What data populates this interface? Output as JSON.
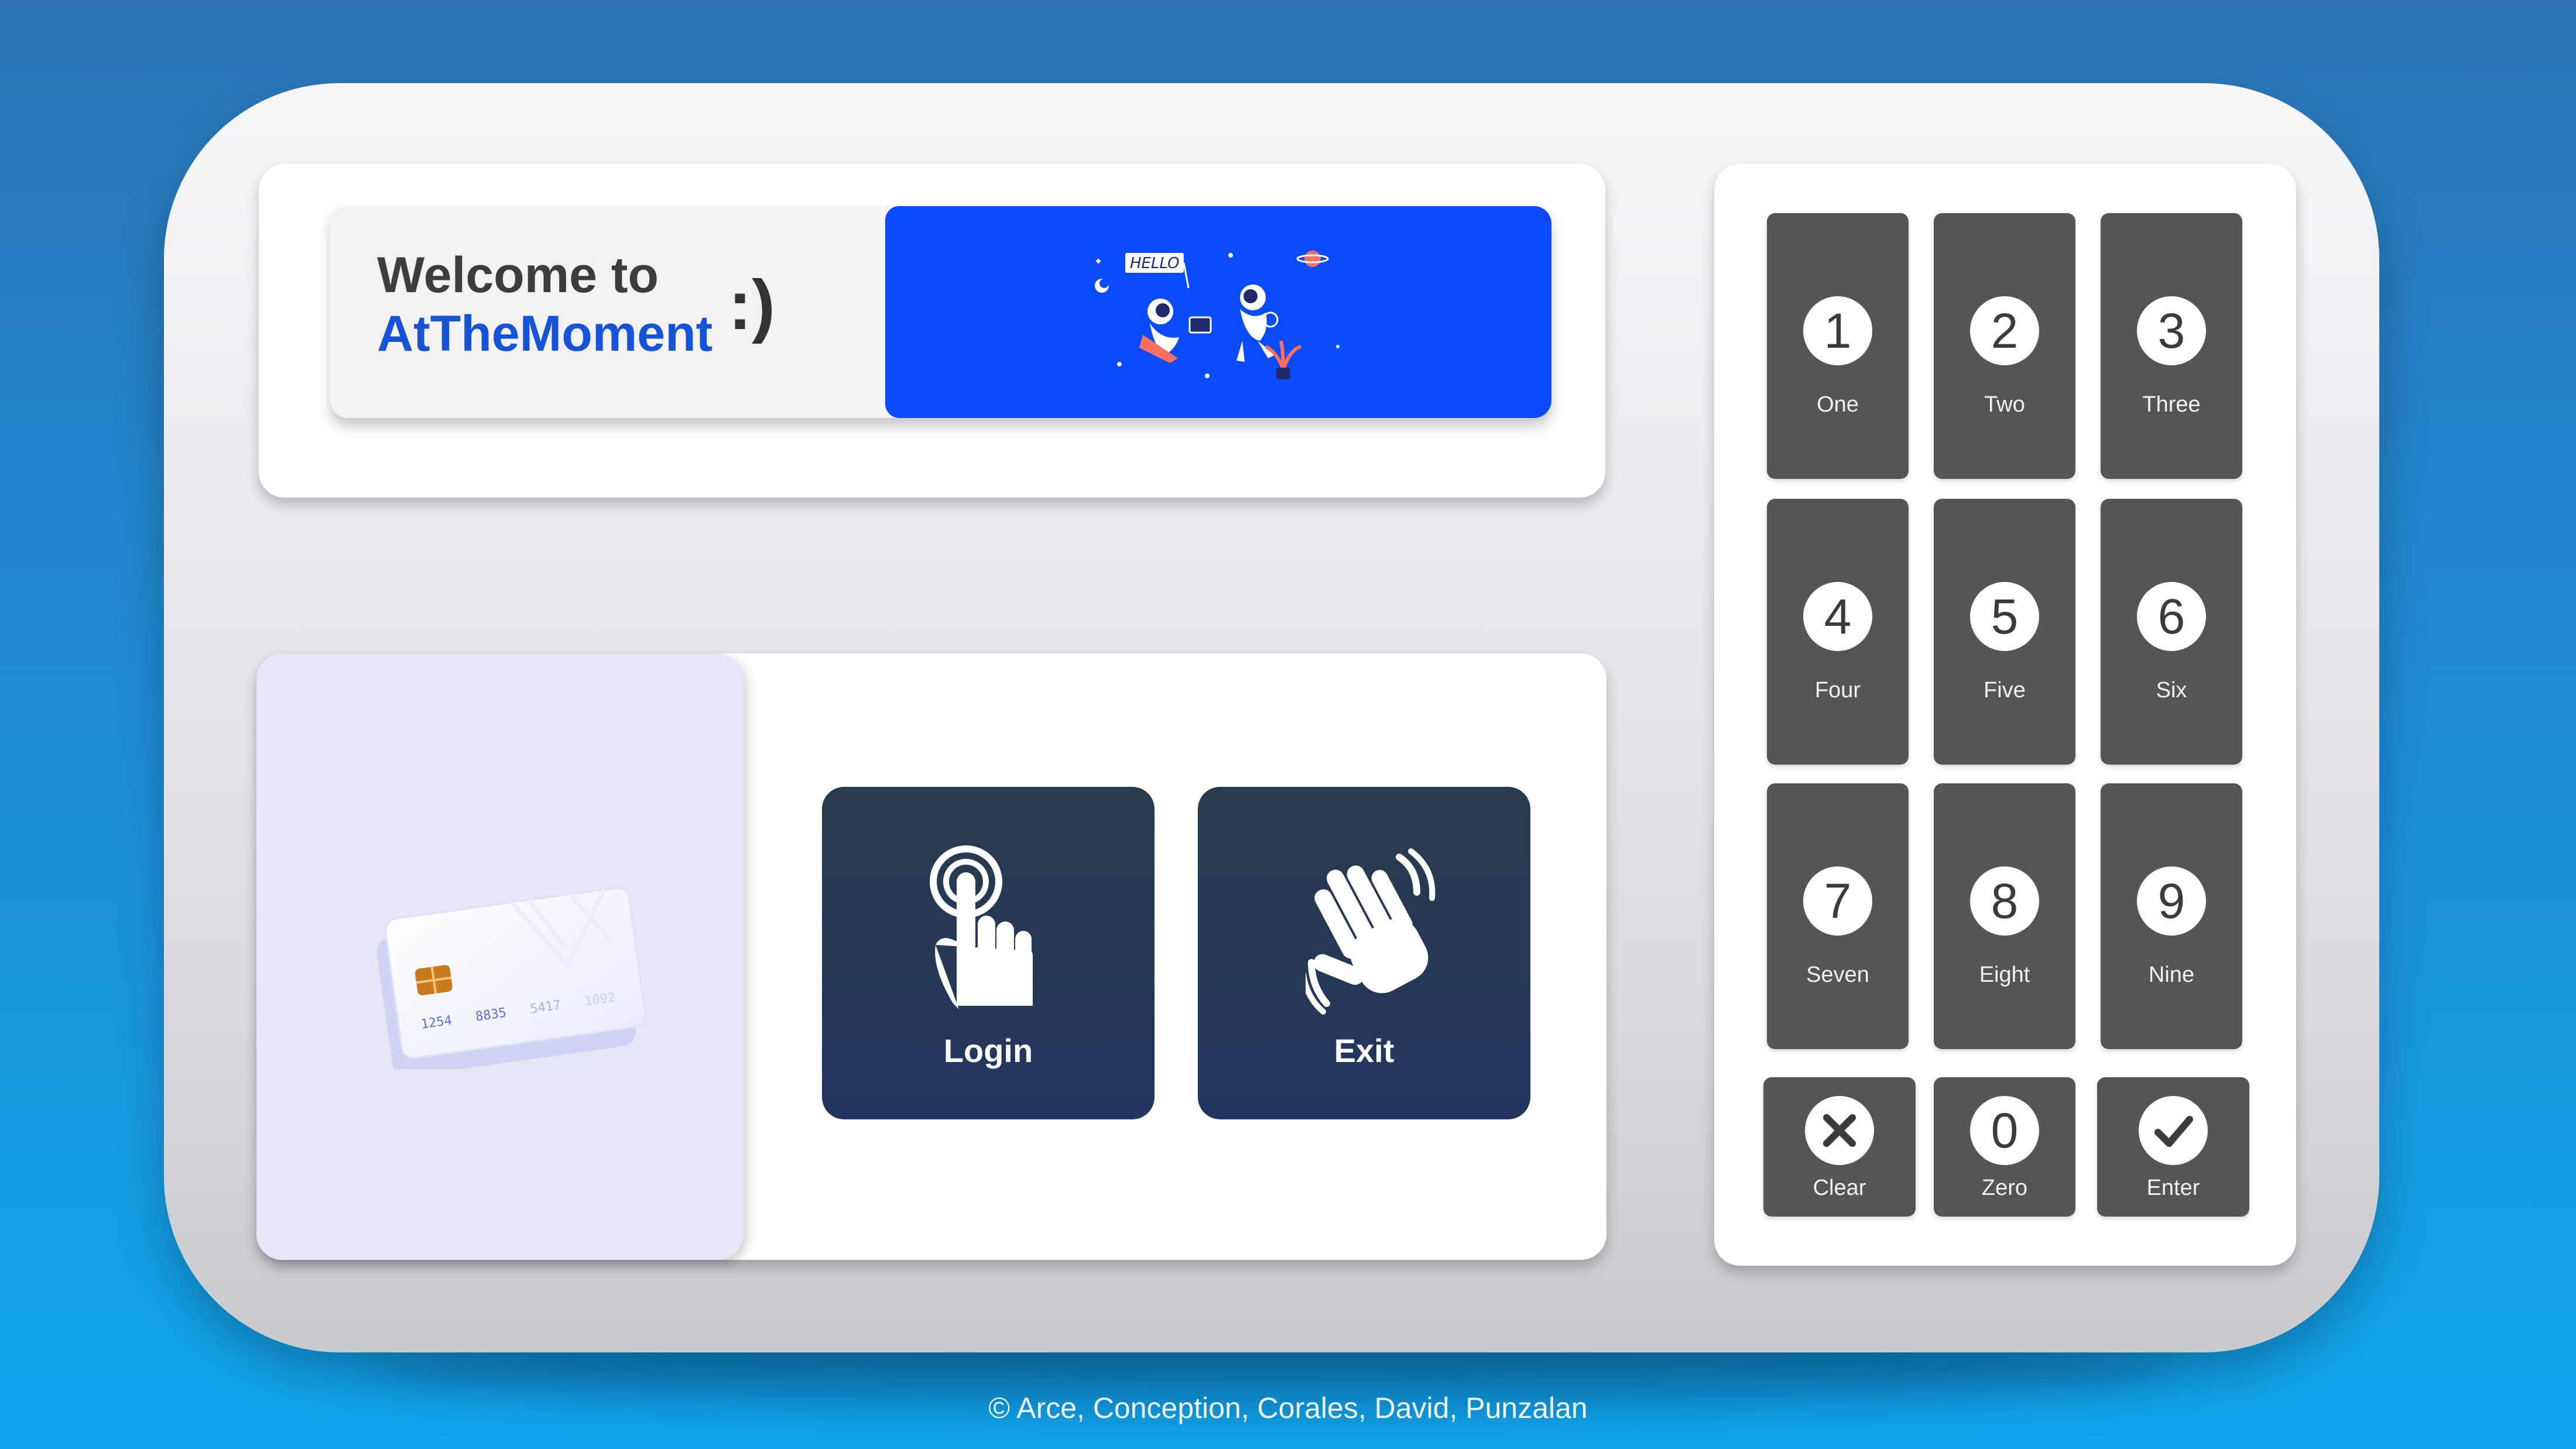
{
  "welcome": {
    "line1": "Welcome to",
    "line2": "AtTheMoment",
    "smiley": ":)",
    "banner_illustration": "astronauts-hello-illustration",
    "banner_text": "HELLO"
  },
  "card": {
    "illustration": "credit-card-icon",
    "number": [
      "1254",
      "8835",
      "5417",
      "1092"
    ]
  },
  "actions": {
    "login": {
      "label": "Login",
      "icon": "touch-hand-icon"
    },
    "exit": {
      "label": "Exit",
      "icon": "waving-hand-icon"
    }
  },
  "keypad": {
    "keys": [
      {
        "digit": "1",
        "label": "One"
      },
      {
        "digit": "2",
        "label": "Two"
      },
      {
        "digit": "3",
        "label": "Three"
      },
      {
        "digit": "4",
        "label": "Four"
      },
      {
        "digit": "5",
        "label": "Five"
      },
      {
        "digit": "6",
        "label": "Six"
      },
      {
        "digit": "7",
        "label": "Seven"
      },
      {
        "digit": "8",
        "label": "Eight"
      },
      {
        "digit": "9",
        "label": "Nine"
      }
    ],
    "clear": {
      "label": "Clear",
      "icon": "close-icon"
    },
    "zero": {
      "digit": "0",
      "label": "Zero"
    },
    "enter": {
      "label": "Enter",
      "icon": "check-icon"
    }
  },
  "footer": {
    "text": "© Arce, Conception, Corales, David, Punzalan"
  },
  "colors": {
    "accent": "#1553d8",
    "banner": "#0b4bff",
    "key": "#555555",
    "action_button": "#22355f"
  }
}
